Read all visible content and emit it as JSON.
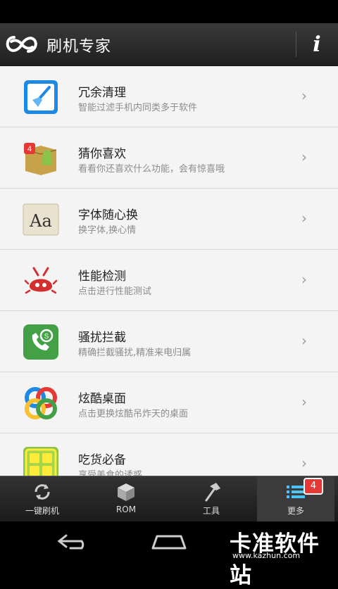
{
  "header": {
    "title": "刷机专家",
    "info_label": "i"
  },
  "items": [
    {
      "title": "冗余清理",
      "subtitle": "智能过滤手机内同类多于软件",
      "icon": "broom-icon"
    },
    {
      "title": "猜你喜欢",
      "subtitle": "看看你还喜欢什么功能，会有惊喜哦",
      "icon": "android-box-icon",
      "badge": "4"
    },
    {
      "title": "字体随心换",
      "subtitle": "换字体,换心情",
      "icon": "font-icon",
      "icon_text": "Aa"
    },
    {
      "title": "性能检测",
      "subtitle": "点击进行性能测试",
      "icon": "antutu-icon"
    },
    {
      "title": "骚扰拦截",
      "subtitle": "精确拦截骚扰,精准来电归属",
      "icon": "phone-shield-icon"
    },
    {
      "title": "炫酷桌面",
      "subtitle": "点击更换炫酷吊炸天的桌面",
      "icon": "go-launcher-icon"
    },
    {
      "title": "吃货必备",
      "subtitle": "享受美食的诱惑",
      "icon": "food-icon"
    }
  ],
  "tabs": [
    {
      "label": "一键刷机",
      "icon": "refresh-icon"
    },
    {
      "label": "ROM",
      "icon": "cube-icon"
    },
    {
      "label": "工具",
      "icon": "hammer-icon"
    },
    {
      "label": "更多",
      "icon": "list-icon",
      "badge": "4",
      "active": true
    }
  ],
  "watermark": {
    "text": "卡准软件站",
    "url": "www.kazhun.com"
  },
  "colors": {
    "accent_red": "#e53935",
    "clean_blue": "#1e88e5",
    "phone_green": "#4caf50",
    "title_bar": "#2a2a2a",
    "list_bg": "#f3f3f3"
  }
}
